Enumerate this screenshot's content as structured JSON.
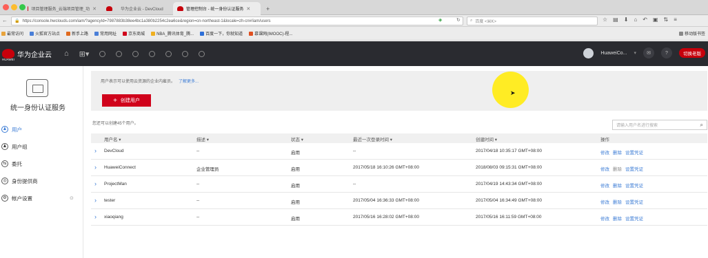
{
  "browser": {
    "tabs": [
      {
        "title": "项目管理服务_云端项目管理_功",
        "active": false
      },
      {
        "title": "华为企业云 - DevCloud",
        "active": false
      },
      {
        "title": "管理控制台 - 统一身份认证服务",
        "active": true
      }
    ],
    "new_tab": "+",
    "url": "https://console.hwclouds.com/iam/?agencyId=7987883b38ee4bc1a380b2254c2ea6ce&region=cn-northeast-1&locale=zh-cn#/iam/users",
    "search_placeholder": "百度 <⌘K>",
    "bookmarks": [
      "最常访问",
      "火狐官方站点",
      "新手上路",
      "常用网址",
      "京东商城",
      "NBA_腾讯体育_腾...",
      "百度一下，你就知道",
      "慕课网(IMOOC)-程..."
    ],
    "mobile_bookmarks": "移动版书签"
  },
  "header": {
    "brand": "华为企业云",
    "brand_sub": "HUAWEI",
    "user": "HuaweiCo...",
    "switch_button": "切换老版"
  },
  "sidebar": {
    "service_title": "统一身份认证服务",
    "items": [
      {
        "label": "用户",
        "icon": "user-icon",
        "active": true
      },
      {
        "label": "用户组",
        "icon": "group-icon",
        "active": false
      },
      {
        "label": "委托",
        "icon": "delegate-icon",
        "active": false
      },
      {
        "label": "身份提供商",
        "icon": "identity-provider-icon",
        "active": false
      },
      {
        "label": "帐户设置",
        "icon": "settings-icon",
        "active": false
      }
    ]
  },
  "main": {
    "info_text": "用户表示可以使用云资源的企业内雇员。",
    "learn_more": "了解更多...",
    "create_button": "创建用户",
    "quota_text": "您还可以创建45个用户。",
    "search_placeholder": "请输入用户名进行搜索",
    "columns": [
      "用户名 ▾",
      "描述 ▾",
      "状态 ▾",
      "最近一次登录时间 ▾",
      "创建时间 ▾",
      "操作"
    ],
    "actions": {
      "edit": "修改",
      "delete": "删除",
      "credentials": "设置凭证"
    },
    "rows": [
      {
        "name": "DevCloud",
        "desc": "--",
        "status": "启用",
        "last_login": "--",
        "created": "2017/04/18 10:35:17 GMT+08:00",
        "delete_disabled": false
      },
      {
        "name": "HuaweiConnect",
        "desc": "企业管理员",
        "status": "启用",
        "last_login": "2017/05/18 16:10:26 GMT+08:00",
        "created": "2018/08/03 09:15:31 GMT+08:00",
        "delete_disabled": true
      },
      {
        "name": "ProjectMan",
        "desc": "--",
        "status": "启用",
        "last_login": "--",
        "created": "2017/04/19 14:43:34 GMT+08:00",
        "delete_disabled": false
      },
      {
        "name": "tester",
        "desc": "--",
        "status": "启用",
        "last_login": "2017/05/04 16:36:33 GMT+08:00",
        "created": "2017/05/04 16:34:49 GMT+08:00",
        "delete_disabled": false
      },
      {
        "name": "xiaoqiang",
        "desc": "--",
        "status": "启用",
        "last_login": "2017/05/16 16:28:02 GMT+08:00",
        "created": "2017/05/16 16:11:59 GMT+08:00",
        "delete_disabled": false
      }
    ]
  }
}
